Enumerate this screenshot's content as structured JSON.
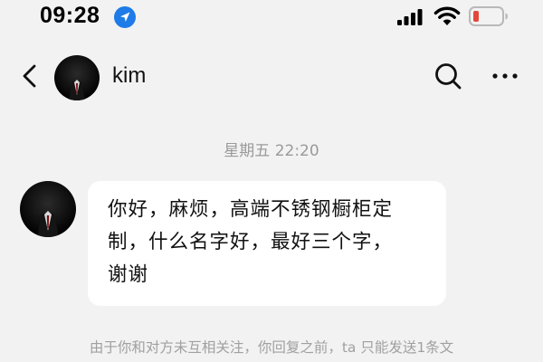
{
  "status_bar": {
    "time": "09:28",
    "battery_color": "#e5483b",
    "location_color": "#1e7be8"
  },
  "header": {
    "contact_name": "kim",
    "icons": {
      "back": "back-chevron-icon",
      "search": "search-icon",
      "more": "more-dots-icon"
    }
  },
  "chat": {
    "timestamp": "星期五 22:20",
    "messages": [
      {
        "sender": "kim",
        "lines": [
          "你好，麻烦，高端不锈钢橱柜定",
          "制，什么名字好，最好三个字，",
          "谢谢"
        ]
      }
    ],
    "notice": "由于你和对方未互相关注，你回复之前，ta 只能发送1条文"
  }
}
